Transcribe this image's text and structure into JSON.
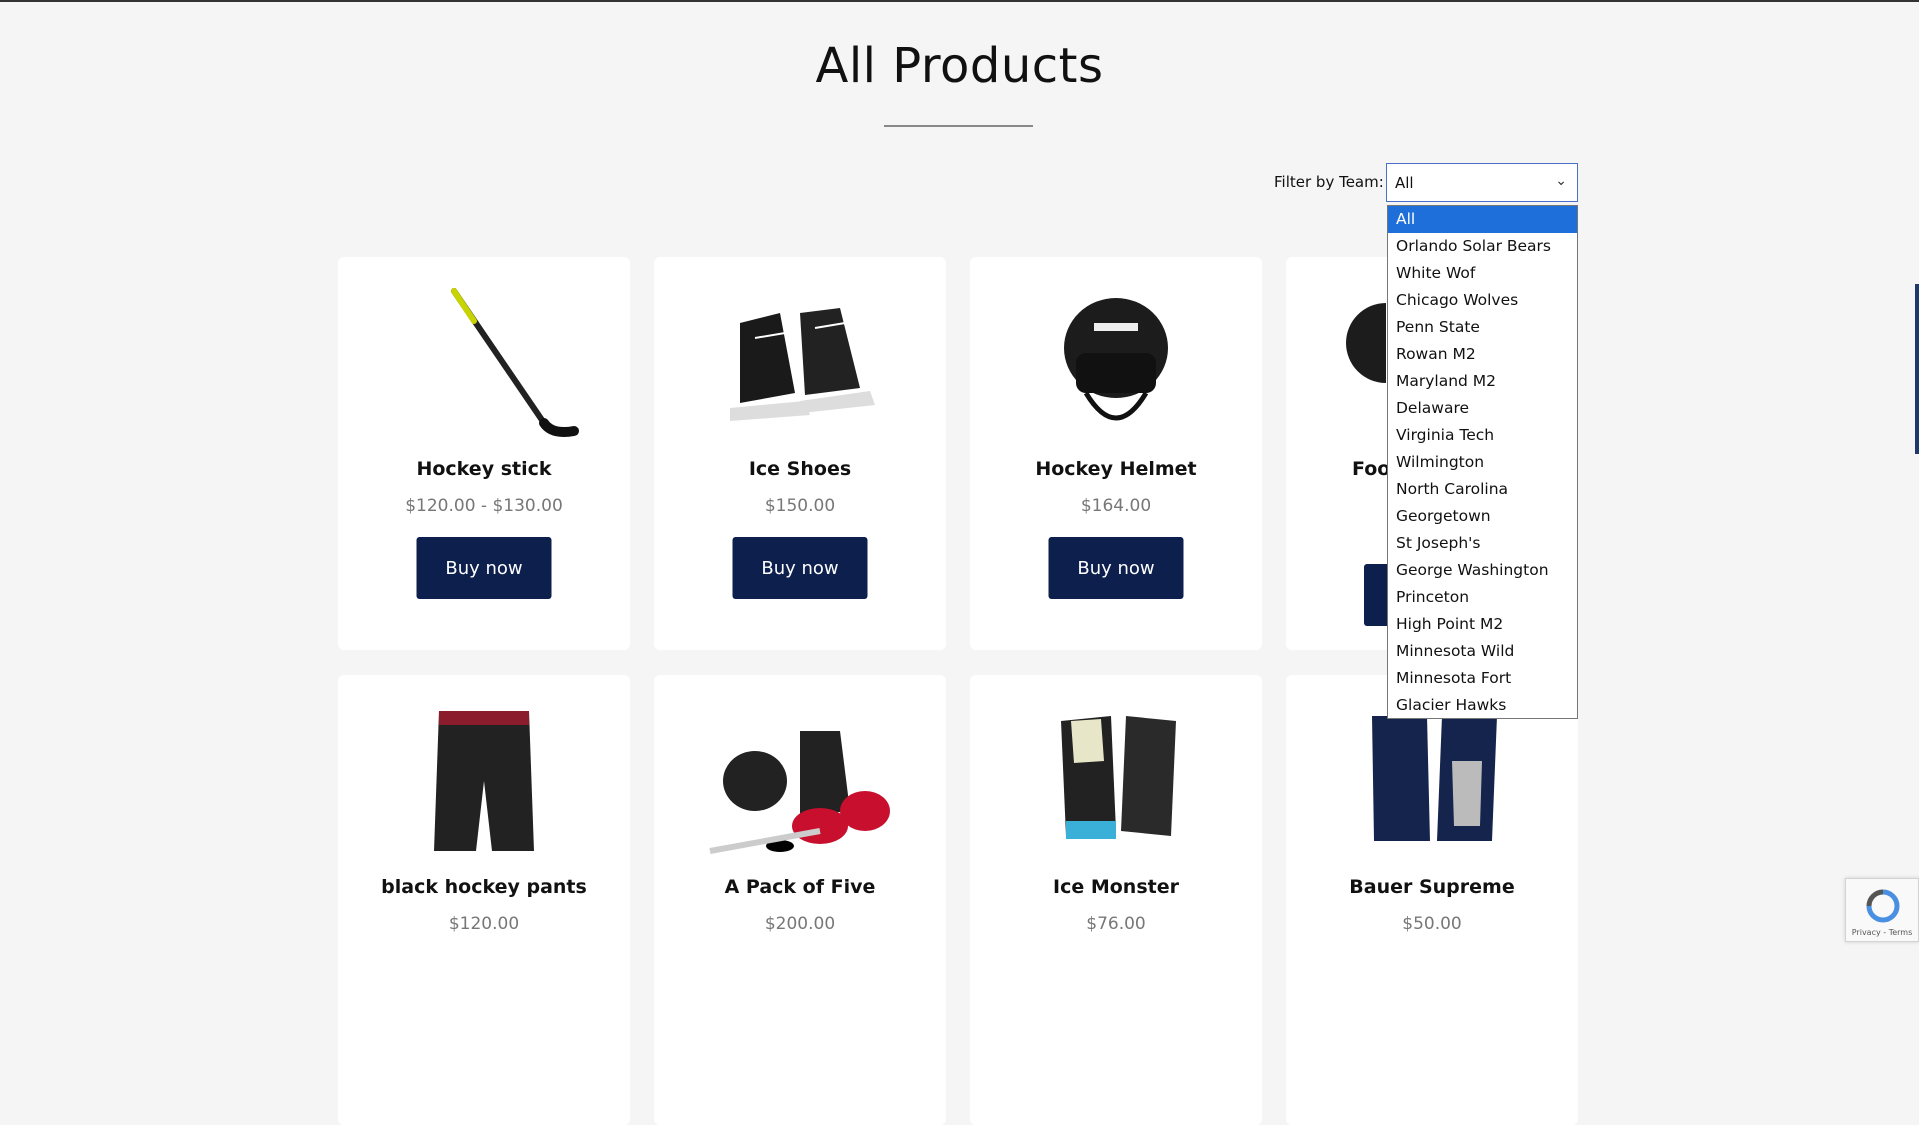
{
  "page": {
    "title": "All Products"
  },
  "filter": {
    "label": "Filter by Team:",
    "selected": "All",
    "options": [
      "All",
      "Orlando Solar Bears",
      "White Wof",
      "Chicago Wolves",
      "Penn State",
      "Rowan M2",
      "Maryland M2",
      "Delaware",
      "Virginia Tech",
      "Wilmington",
      "North Carolina",
      "Georgetown",
      "St Joseph's",
      "George Washington",
      "Princeton",
      "High Point M2",
      "Minnesota Wild",
      "Minnesota Fort",
      "Glacier Hawks"
    ]
  },
  "products": [
    {
      "name": "Hockey stick",
      "price": "$120.00 - $130.00",
      "button": "Buy now",
      "icon": "hockey-stick-image"
    },
    {
      "name": "Ice Shoes",
      "price": "$150.00",
      "button": "Buy now",
      "icon": "ice-skates-image"
    },
    {
      "name": "Hockey Helmet",
      "price": "$164.00",
      "button": "Buy now",
      "icon": "hockey-helmet-image"
    },
    {
      "name": "Foo",
      "price": "",
      "button": "",
      "icon": "helmet-image"
    },
    {
      "name": "black hockey pants",
      "price": "$120.00",
      "button": "",
      "icon": "hockey-pants-image"
    },
    {
      "name": "A Pack of Five",
      "price": "$200.00",
      "button": "",
      "icon": "gear-pack-image"
    },
    {
      "name": "Ice Monster",
      "price": "$76.00",
      "button": "",
      "icon": "gloves-image"
    },
    {
      "name": "Bauer Supreme",
      "price": "$50.00",
      "button": "",
      "icon": "gloves-navy-image"
    }
  ],
  "recaptcha": {
    "text": "Privacy - Terms"
  },
  "colors": {
    "button": "#0d1f4d",
    "selected_option": "#1e6fd9",
    "background": "#f5f5f5"
  }
}
